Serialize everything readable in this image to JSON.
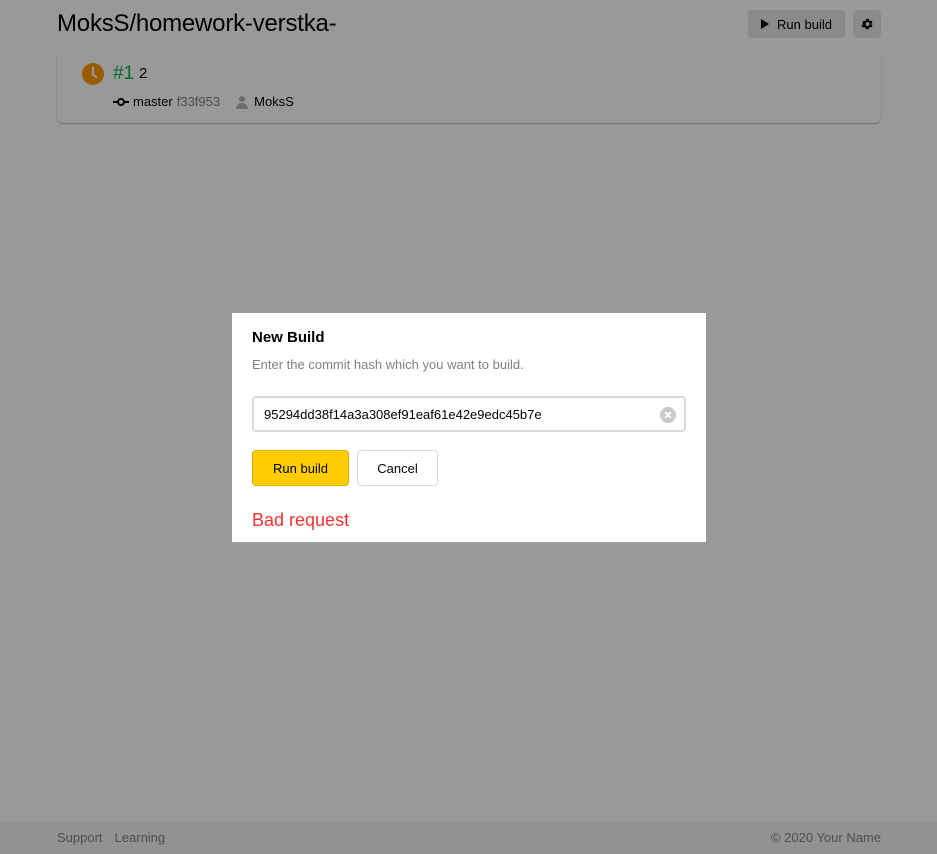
{
  "header": {
    "title": "MoksS/homework-verstka-",
    "run_build_label": "Run build"
  },
  "build": {
    "status": "pending",
    "number": "#1",
    "message": "2",
    "branch": "master",
    "commit": "f33f953",
    "author": "MoksS"
  },
  "footer": {
    "links": [
      "Support",
      "Learning"
    ],
    "copyright": "© 2020 Your Name"
  },
  "modal": {
    "title": "New Build",
    "subtitle": "Enter the commit hash which you want to build.",
    "hash_value": "95294dd38f14a3a308ef91eaf61e42e9edc45b7e",
    "run_label": "Run build",
    "cancel_label": "Cancel",
    "error": "Bad request"
  },
  "colors": {
    "accent": "#ffcc00",
    "success": "#00b341",
    "pending": "#ff9a00",
    "error": "#f73131",
    "muted": "#7f8285"
  },
  "icons": {
    "run": "play-icon",
    "settings": "gear-icon",
    "status": "clock-icon",
    "branch": "commit-branch-icon",
    "author": "user-icon",
    "clear": "clear-icon"
  }
}
